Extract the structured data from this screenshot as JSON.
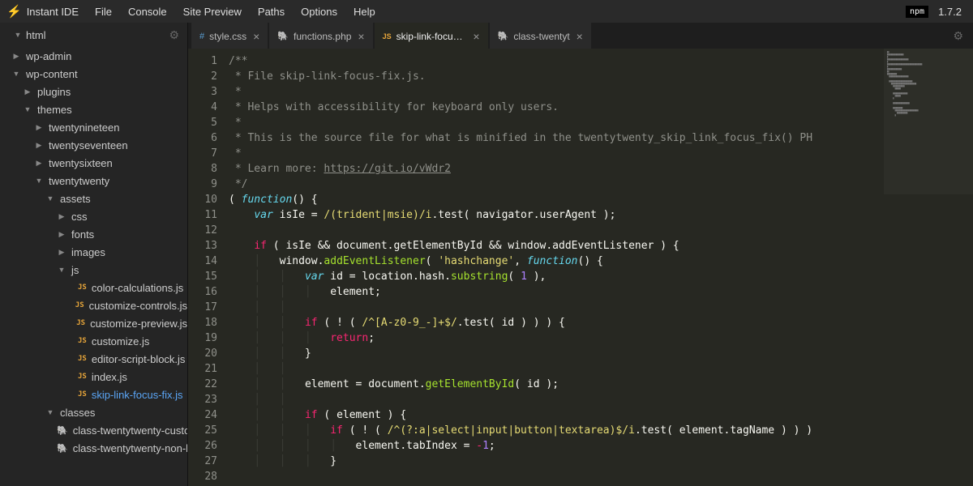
{
  "app": {
    "title": "Instant IDE",
    "version": "1.7.2",
    "npm_badge": "npm"
  },
  "menu": [
    "File",
    "Console",
    "Site Preview",
    "Paths",
    "Options",
    "Help"
  ],
  "sidebar": {
    "root": "html",
    "tree": [
      {
        "label": "wp-admin",
        "depth": 0,
        "arrow": "▶",
        "icon": "folder"
      },
      {
        "label": "wp-content",
        "depth": 0,
        "arrow": "▼",
        "icon": "folder"
      },
      {
        "label": "plugins",
        "depth": 1,
        "arrow": "▶",
        "icon": "folder"
      },
      {
        "label": "themes",
        "depth": 1,
        "arrow": "▼",
        "icon": "folder"
      },
      {
        "label": "twentynineteen",
        "depth": 2,
        "arrow": "▶",
        "icon": "folder"
      },
      {
        "label": "twentyseventeen",
        "depth": 2,
        "arrow": "▶",
        "icon": "folder"
      },
      {
        "label": "twentysixteen",
        "depth": 2,
        "arrow": "▶",
        "icon": "folder"
      },
      {
        "label": "twentytwenty",
        "depth": 2,
        "arrow": "▼",
        "icon": "folder"
      },
      {
        "label": "assets",
        "depth": 3,
        "arrow": "▼",
        "icon": "folder"
      },
      {
        "label": "css",
        "depth": 4,
        "arrow": "▶",
        "icon": "folder"
      },
      {
        "label": "fonts",
        "depth": 4,
        "arrow": "▶",
        "icon": "folder"
      },
      {
        "label": "images",
        "depth": 4,
        "arrow": "▶",
        "icon": "folder"
      },
      {
        "label": "js",
        "depth": 4,
        "arrow": "▼",
        "icon": "folder"
      },
      {
        "label": "color-calculations.js",
        "depth": 5,
        "arrow": "",
        "icon": "js"
      },
      {
        "label": "customize-controls.js",
        "depth": 5,
        "arrow": "",
        "icon": "js"
      },
      {
        "label": "customize-preview.js",
        "depth": 5,
        "arrow": "",
        "icon": "js"
      },
      {
        "label": "customize.js",
        "depth": 5,
        "arrow": "",
        "icon": "js"
      },
      {
        "label": "editor-script-block.js",
        "depth": 5,
        "arrow": "",
        "icon": "js"
      },
      {
        "label": "index.js",
        "depth": 5,
        "arrow": "",
        "icon": "js"
      },
      {
        "label": "skip-link-focus-fix.js",
        "depth": 5,
        "arrow": "",
        "icon": "js",
        "active": true
      },
      {
        "label": "classes",
        "depth": 3,
        "arrow": "▼",
        "icon": "folder"
      },
      {
        "label": "class-twentytwenty-customize",
        "depth": 4,
        "arrow": "",
        "icon": "php"
      },
      {
        "label": "class-twentytwenty-non-latin-",
        "depth": 4,
        "arrow": "",
        "icon": "php"
      }
    ]
  },
  "tabs": [
    {
      "label": "style.css",
      "icon": "css",
      "close": true
    },
    {
      "label": "functions.php",
      "icon": "php",
      "close": true
    },
    {
      "label": "skip-link-focus-fix",
      "icon": "js",
      "close": true,
      "active": true
    },
    {
      "label": "class-twentyt",
      "icon": "php",
      "close": true
    }
  ],
  "code": {
    "line_count": 28,
    "lines": {
      "l1": "/**",
      "l2": " * File skip-link-focus-fix.js.",
      "l3": " *",
      "l4": " * Helps with accessibility for keyboard only users.",
      "l5": " *",
      "l6": " * This is the source file for what is minified in the twentytwenty_skip_link_focus_fix() PH",
      "l7": " *",
      "l8a": " * Learn more: ",
      "l8b": "https://git.io/vWdr2",
      "l9": " */",
      "l10a": "( ",
      "l10b": "function",
      "l10c": "() {",
      "l11a": "var",
      "l11b": " isIe = ",
      "l11c": "/(trident|msie)/i",
      "l11d": ".test( navigator.userAgent );",
      "l13a": "if",
      "l13b": " ( isIe && document.getElementById && window.addEventListener ) {",
      "l14a": "window.",
      "l14b": "addEventListener",
      "l14c": "( ",
      "l14d": "'hashchange'",
      "l14e": ", ",
      "l14f": "function",
      "l14g": "() {",
      "l15a": "var",
      "l15b": " id = location.hash.",
      "l15c": "substring",
      "l15d": "( ",
      "l15e": "1",
      "l15f": " ),",
      "l16": "element;",
      "l18a": "if",
      "l18b": " ( ! ( ",
      "l18c": "/^[A-z0-9_-]+$/",
      "l18d": ".test( id ) ) ) {",
      "l19": "return",
      "l19b": ";",
      "l20": "}",
      "l22a": "element = document.",
      "l22b": "getElementById",
      "l22c": "( id );",
      "l24a": "if",
      "l24b": " ( element ) {",
      "l25a": "if",
      "l25b": " ( ! ( ",
      "l25c": "/^(?:a|select|input|button|textarea)$/i",
      "l25d": ".test( element.tagName ) ) )",
      "l26a": "element.tabIndex = ",
      "l26b": "-",
      "l26c": "1",
      "l26d": ";",
      "l27": "}"
    }
  }
}
